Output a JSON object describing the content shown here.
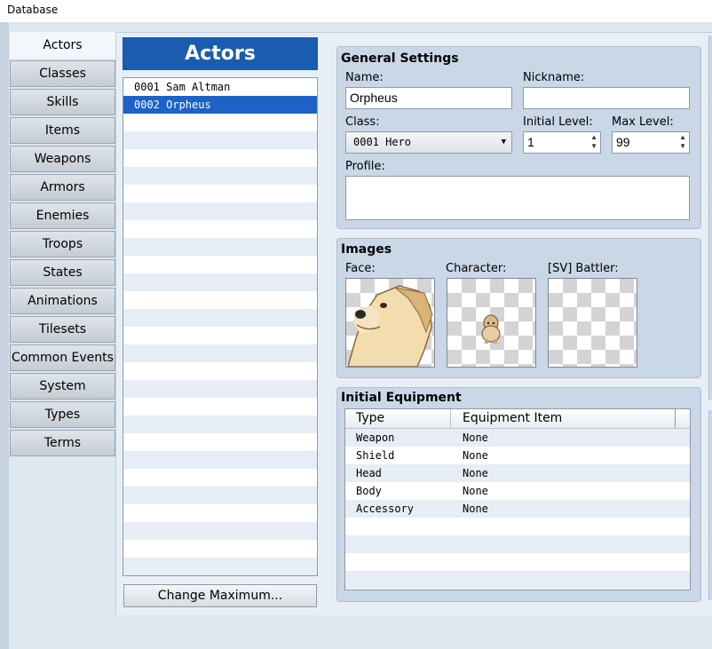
{
  "window": {
    "title": "Database"
  },
  "tabs": [
    "Actors",
    "Classes",
    "Skills",
    "Items",
    "Weapons",
    "Armors",
    "Enemies",
    "Troops",
    "States",
    "Animations",
    "Tilesets",
    "Common Events",
    "System",
    "Types",
    "Terms"
  ],
  "active_tab": "Actors",
  "list": {
    "header": "Actors",
    "items": [
      "0001 Sam Altman",
      "0002 Orpheus"
    ],
    "selected": "0002 Orpheus",
    "change_max_label": "Change Maximum..."
  },
  "general": {
    "title": "General Settings",
    "name_label": "Name:",
    "name_value": "Orpheus",
    "nickname_label": "Nickname:",
    "nickname_value": "",
    "class_label": "Class:",
    "class_value": "0001 Hero",
    "initial_level_label": "Initial Level:",
    "initial_level_value": "1",
    "max_level_label": "Max Level:",
    "max_level_value": "99",
    "profile_label": "Profile:",
    "profile_value": ""
  },
  "images": {
    "title": "Images",
    "face_label": "Face:",
    "character_label": "Character:",
    "battler_label": "[SV] Battler:"
  },
  "equipment": {
    "title": "Initial Equipment",
    "col_type": "Type",
    "col_item": "Equipment Item",
    "rows": [
      {
        "type": "Weapon",
        "item": "None"
      },
      {
        "type": "Shield",
        "item": "None"
      },
      {
        "type": "Head",
        "item": "None"
      },
      {
        "type": "Body",
        "item": "None"
      },
      {
        "type": "Accessory",
        "item": "None"
      }
    ]
  },
  "colors": {
    "accent": "#1a5cad",
    "selection": "#1d62c6",
    "panel": "#c9d7e6"
  }
}
